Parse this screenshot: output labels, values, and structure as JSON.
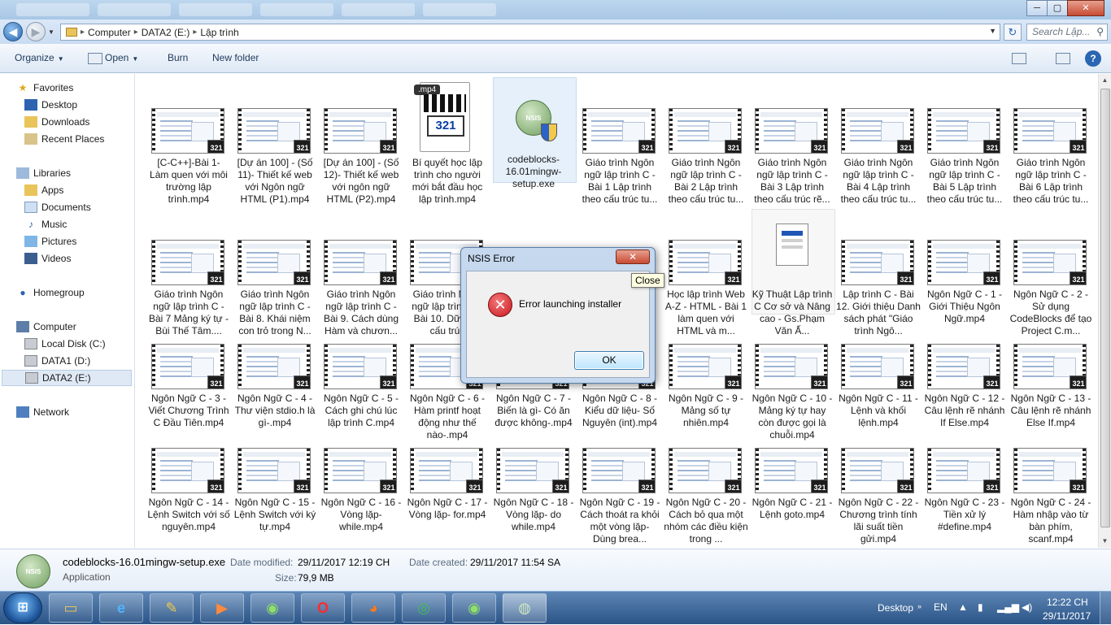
{
  "window": {
    "min_symbol": "─",
    "max_symbol": "▢",
    "close_symbol": "✕"
  },
  "address": {
    "segments": [
      "Computer",
      "DATA2 (E:)",
      "Lập trình"
    ],
    "search_placeholder": "Search Lập..."
  },
  "toolbar": {
    "organize": "Organize",
    "open": "Open",
    "burn": "Burn",
    "new_folder": "New folder"
  },
  "sidebar": {
    "favorites": "Favorites",
    "desktop": "Desktop",
    "downloads": "Downloads",
    "recent": "Recent Places",
    "libraries": "Libraries",
    "apps": "Apps",
    "documents": "Documents",
    "music": "Music",
    "pictures": "Pictures",
    "videos": "Videos",
    "homegroup": "Homegroup",
    "computer": "Computer",
    "local_disk": "Local Disk (C:)",
    "data1": "DATA1 (D:)",
    "data2": "DATA2 (E:)",
    "network": "Network"
  },
  "files": [
    {
      "name": "[C-C++]-Bài 1- Làm quen với môi trường lập trình.mp4",
      "kind": "video"
    },
    {
      "name": "[Dự án 100] - (Số 11)- Thiết kế web với Ngôn ngữ HTML (P1).mp4",
      "kind": "video"
    },
    {
      "name": "[Dự án 100] - (Số 12)- Thiết kế web với ngôn ngữ HTML (P2).mp4",
      "kind": "video"
    },
    {
      "name": "Bí quyết học lập trình cho người mới bắt đầu học lập trình.mp4",
      "kind": "mp4icon"
    },
    {
      "name": "codeblocks-16.01mingw-setup.exe",
      "kind": "exe"
    },
    {
      "name": "Giáo trình Ngôn ngữ lập trình C - Bài 1 Lập trình theo cấu trúc tu...",
      "kind": "video"
    },
    {
      "name": "Giáo trình Ngôn ngữ lập trình C - Bài 2 Lập trình theo cấu trúc tu...",
      "kind": "video"
    },
    {
      "name": "Giáo trình Ngôn ngữ lập trình C - Bài 3 Lập trình theo cấu trúc rẽ...",
      "kind": "video"
    },
    {
      "name": "Giáo trình Ngôn ngữ lập trình C - Bài 4 Lập trình theo cấu trúc tu...",
      "kind": "video"
    },
    {
      "name": "Giáo trình Ngôn ngữ lập trình C - Bài 5 Lập trình theo cấu trúc tu...",
      "kind": "video"
    },
    {
      "name": "Giáo trình Ngôn ngữ lập trình C - Bài 6 Lập trình theo cấu trúc tu...",
      "kind": "video"
    },
    {
      "name": "Giáo trình Ngôn ngữ lập trình C - Bài 7 Mảng ký tự - Bùi Thế Tâm....",
      "kind": "video"
    },
    {
      "name": "Giáo trình Ngôn ngữ lập trình C - Bài 8. Khái niệm con trỏ trong N...",
      "kind": "video"
    },
    {
      "name": "Giáo trình Ngôn ngữ lập trình C - Bài 9. Cách dùng Hàm và chươn...",
      "kind": "video"
    },
    {
      "name": "Giáo trình Ngôn ngữ lập trình C - Bài 10. Dữ kiểu cấu trúc",
      "kind": "video"
    },
    {
      "name": "",
      "kind": "hidden"
    },
    {
      "name": "",
      "kind": "hidden"
    },
    {
      "name": "Học lập trình Web A-Z - HTML - Bài 1 làm quen với HTML và m...",
      "kind": "video"
    },
    {
      "name": "Kỹ Thuật Lập trình C Cơ sở và Nâng cao - Gs.Phạm Văn Ấ...",
      "kind": "chm"
    },
    {
      "name": "Lập trình C - Bài 12. Giới thiệu Danh sách phát \"Giáo trình Ngô...",
      "kind": "video"
    },
    {
      "name": "Ngôn Ngữ C - 1 - Giới Thiệu Ngôn Ngữ.mp4",
      "kind": "video"
    },
    {
      "name": "Ngôn Ngữ C - 2 - Sử dụng CodeBlocks để tạo Project C.m...",
      "kind": "video"
    },
    {
      "name": "Ngôn Ngữ C - 3 - Viết Chương Trình C Đầu Tiên.mp4",
      "kind": "video"
    },
    {
      "name": "Ngôn Ngữ C - 4 - Thư viện stdio.h là gì-.mp4",
      "kind": "video"
    },
    {
      "name": "Ngôn Ngữ C - 5 - Cách ghi chú lúc lập trình C.mp4",
      "kind": "video"
    },
    {
      "name": "Ngôn Ngữ C - 6 - Hàm printf hoạt động như thế nào-.mp4",
      "kind": "video"
    },
    {
      "name": "Ngôn Ngữ C - 7 - Biến là gì- Có ăn được không-.mp4",
      "kind": "video"
    },
    {
      "name": "Ngôn Ngữ C - 8 - Kiểu dữ liệu- Số Nguyên (int).mp4",
      "kind": "video"
    },
    {
      "name": "Ngôn Ngữ C - 9 - Mảng số tự nhiên.mp4",
      "kind": "video"
    },
    {
      "name": "Ngôn Ngữ C - 10 - Mảng ký tự hay còn được gọi là chuỗi.mp4",
      "kind": "video"
    },
    {
      "name": "Ngôn Ngữ C - 11 - Lệnh và khối lệnh.mp4",
      "kind": "video"
    },
    {
      "name": "Ngôn Ngữ C - 12 - Câu lệnh rẽ nhánh If Else.mp4",
      "kind": "video"
    },
    {
      "name": "Ngôn Ngữ C - 13 - Câu lệnh rẽ nhánh Else If.mp4",
      "kind": "video"
    },
    {
      "name": "Ngôn Ngữ C - 14 - Lệnh Switch với số nguyên.mp4",
      "kind": "video"
    },
    {
      "name": "Ngôn Ngữ C - 15 - Lệnh Switch với ký tự.mp4",
      "kind": "video"
    },
    {
      "name": "Ngôn Ngữ C - 16 - Vòng lặp- while.mp4",
      "kind": "video"
    },
    {
      "name": "Ngôn Ngữ C - 17 - Vòng lặp- for.mp4",
      "kind": "video"
    },
    {
      "name": "Ngôn Ngữ C - 18 - Vòng lặp- do while.mp4",
      "kind": "video"
    },
    {
      "name": "Ngôn Ngữ C - 19 - Cách thoát ra khỏi một vòng lặp- Dùng brea...",
      "kind": "video"
    },
    {
      "name": "Ngôn Ngữ C - 20 - Cách bỏ qua một nhóm các điều kiện trong ...",
      "kind": "video"
    },
    {
      "name": "Ngôn Ngữ C - 21 - Lệnh goto.mp4",
      "kind": "video"
    },
    {
      "name": "Ngôn Ngữ C - 22 - Chương trình tính lãi suất tiền gửi.mp4",
      "kind": "video"
    },
    {
      "name": "Ngôn Ngữ C - 23 - Tiền xử lý #define.mp4",
      "kind": "video"
    },
    {
      "name": "Ngôn Ngữ C - 24 - Hàm nhập vào từ bàn phím, scanf.mp4",
      "kind": "video"
    }
  ],
  "badges": {
    "video": "321",
    "mp4_tag": ".mp4",
    "exe_tag": "NSIS"
  },
  "dialog": {
    "title": "NSIS Error",
    "close_label": "✕",
    "message": "Error launching installer",
    "ok": "OK",
    "tooltip": "Close"
  },
  "details": {
    "name": "codeblocks-16.01mingw-setup.exe",
    "type": "Application",
    "modified_label": "Date modified:",
    "modified": "29/11/2017 12:19 CH",
    "created_label": "Date created:",
    "created": "29/11/2017 11:54 SA",
    "size_label": "Size:",
    "size": "79,9 MB"
  },
  "taskbar": {
    "desktop": "Desktop",
    "lang": "EN",
    "time": "12:22 CH",
    "date": "29/11/2017"
  },
  "colors": {
    "accent": "#2a66b1",
    "error": "#c8161d",
    "selection": "#e5f0fb"
  }
}
